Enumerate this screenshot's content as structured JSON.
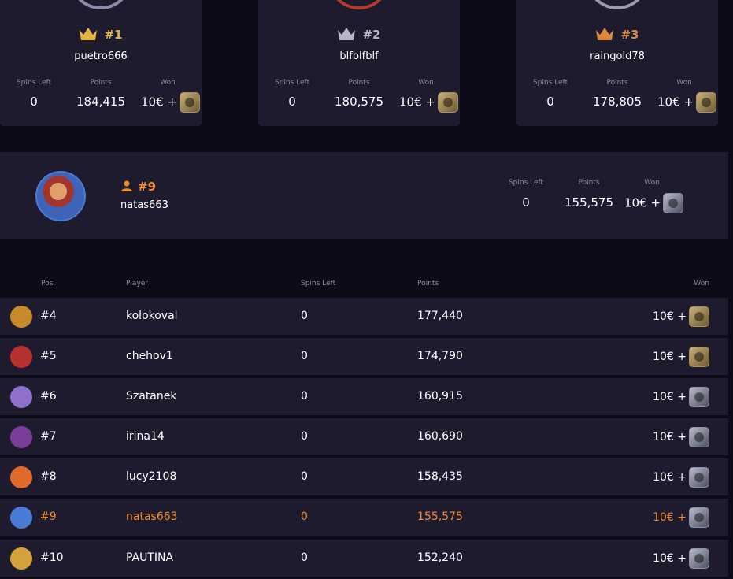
{
  "podium": [
    {
      "rank": "#1",
      "name": "puetro666",
      "spins_label": "Spins Left",
      "spins": "0",
      "points_label": "Points",
      "points": "184,415",
      "won_label": "Won",
      "won": "10€ +",
      "crown_color": "#e5b443",
      "box": "gold-box-icon"
    },
    {
      "rank": "#2",
      "name": "blfblfblf",
      "spins_label": "Spins Left",
      "spins": "0",
      "points_label": "Points",
      "points": "180,575",
      "won_label": "Won",
      "won": "10€ +",
      "crown_color": "#b8b7c7",
      "box": "gold-box-icon"
    },
    {
      "rank": "#3",
      "name": "raingold78",
      "spins_label": "Spins Left",
      "spins": "0",
      "points_label": "Points",
      "points": "178,805",
      "won_label": "Won",
      "won": "10€ +",
      "crown_color": "#d98a3e",
      "box": "gold-box-icon"
    }
  ],
  "my_position": {
    "rank": "#9",
    "name": "natas663",
    "spins_label": "Spins Left",
    "spins": "0",
    "points_label": "Points",
    "points": "155,575",
    "won_label": "Won",
    "won": "10€ +",
    "accent": "#f08a2b"
  },
  "table": {
    "headers": {
      "pos": "Pos.",
      "player": "Player",
      "spins": "Spins Left",
      "points": "Points",
      "won": "Won"
    },
    "rows": [
      {
        "pos": "#4",
        "player": "kolokoval",
        "spins": "0",
        "points": "177,440",
        "won": "10€ +",
        "box": "gold",
        "avatar_color": "#c78a2a"
      },
      {
        "pos": "#5",
        "player": "chehov1",
        "spins": "0",
        "points": "174,790",
        "won": "10€ +",
        "box": "gold",
        "avatar_color": "#b5322f"
      },
      {
        "pos": "#6",
        "player": "Szatanek",
        "spins": "0",
        "points": "160,915",
        "won": "10€ +",
        "box": "silver",
        "avatar_color": "#8e6fc9"
      },
      {
        "pos": "#7",
        "player": "irina14",
        "spins": "0",
        "points": "160,690",
        "won": "10€ +",
        "box": "silver",
        "avatar_color": "#7a3d9a"
      },
      {
        "pos": "#8",
        "player": "lucy2108",
        "spins": "0",
        "points": "158,435",
        "won": "10€ +",
        "box": "silver",
        "avatar_color": "#e06a2a"
      },
      {
        "pos": "#9",
        "player": "natas663",
        "spins": "0",
        "points": "155,575",
        "won": "10€ +",
        "box": "silver",
        "avatar_color": "#4a7bd6"
      },
      {
        "pos": "#10",
        "player": "PAUTINA",
        "spins": "0",
        "points": "152,240",
        "won": "10€ +",
        "box": "silver",
        "avatar_color": "#d4a13a"
      }
    ]
  }
}
